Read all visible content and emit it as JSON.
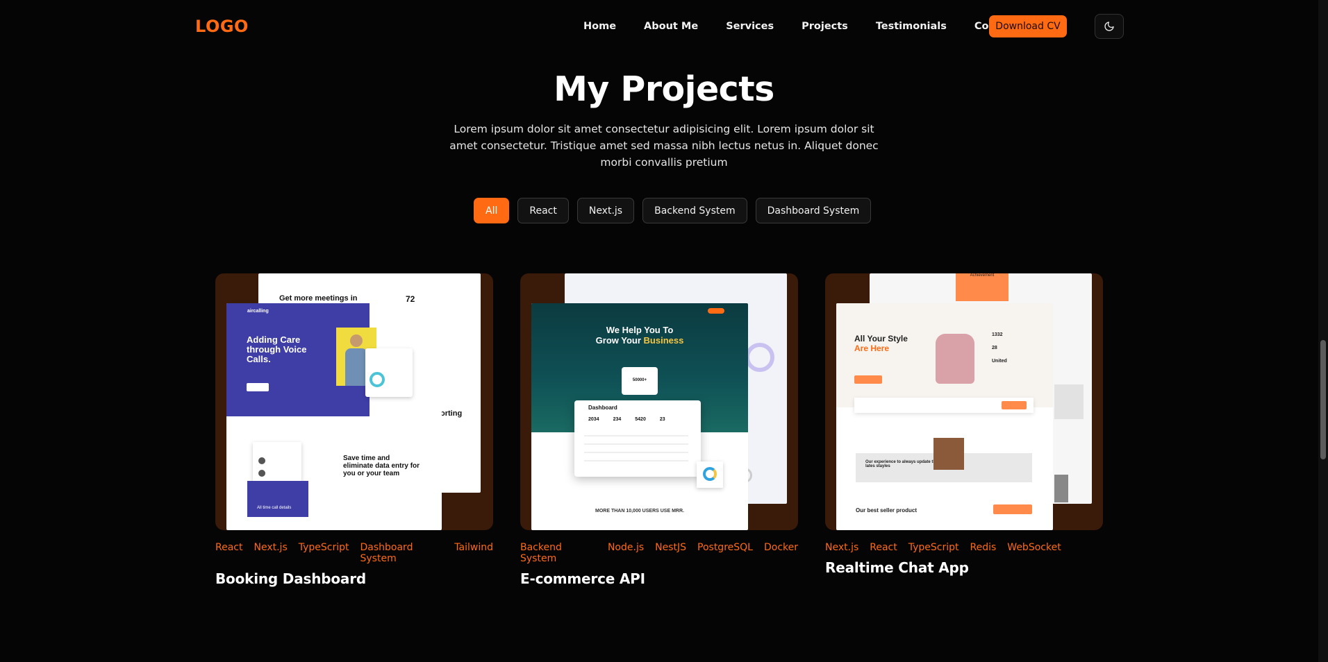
{
  "nav": {
    "logo": "LOGO",
    "links": [
      "Home",
      "About Me",
      "Services",
      "Projects",
      "Testimonials",
      "Contact"
    ],
    "download_cv": "Download CV",
    "theme_icon": "moon-icon"
  },
  "header": {
    "title": "My Projects",
    "subtitle": "Lorem ipsum dolor sit amet consectetur adipisicing elit. Lorem ipsum dolor sit amet consectetur. Tristique amet sed massa nibh lectus netus in. Aliquet donec morbi convallis pretium"
  },
  "filters": [
    "All",
    "React",
    "Next.js",
    "Backend System",
    "Dashboard System"
  ],
  "active_filter": "All",
  "projects": [
    {
      "title": "Booking Dashboard",
      "tags": [
        "React",
        "Next.js",
        "TypeScript",
        "Dashboard System",
        "Tailwind"
      ],
      "preview": {
        "back_heading": "Get more meetings in",
        "back_number": "72",
        "back_text": "orting",
        "brand": "aircalling",
        "hero": "Adding Care through Voice Calls.",
        "section": "Save time and eliminate data entry for you or your team",
        "list_item": "All time call details"
      }
    },
    {
      "title": "E-commerce API",
      "tags": [
        "Backend System",
        "Node.js",
        "NestJS",
        "PostgreSQL",
        "Docker"
      ],
      "preview": {
        "hero_line1": "We Help You To",
        "hero_line2": "Grow Your",
        "hero_accent": "Business",
        "panel": "Dashboard",
        "stat": "50000+",
        "stats": [
          "2034",
          "234",
          "5420",
          "23"
        ],
        "footer": "MORE THAN 10,000 USERS USE MRR."
      }
    },
    {
      "title": "Realtime Chat App",
      "tags": [
        "Next.js",
        "React",
        "TypeScript",
        "Redis",
        "WebSocket"
      ],
      "preview": {
        "badge": "Achievement",
        "hero_line1": "All Your Style",
        "hero_line2": "Are Here",
        "stats": [
          "1332",
          "28",
          "United"
        ],
        "quote": "Our experience to always update the lates stayles",
        "section": "Our best seller product"
      }
    }
  ]
}
